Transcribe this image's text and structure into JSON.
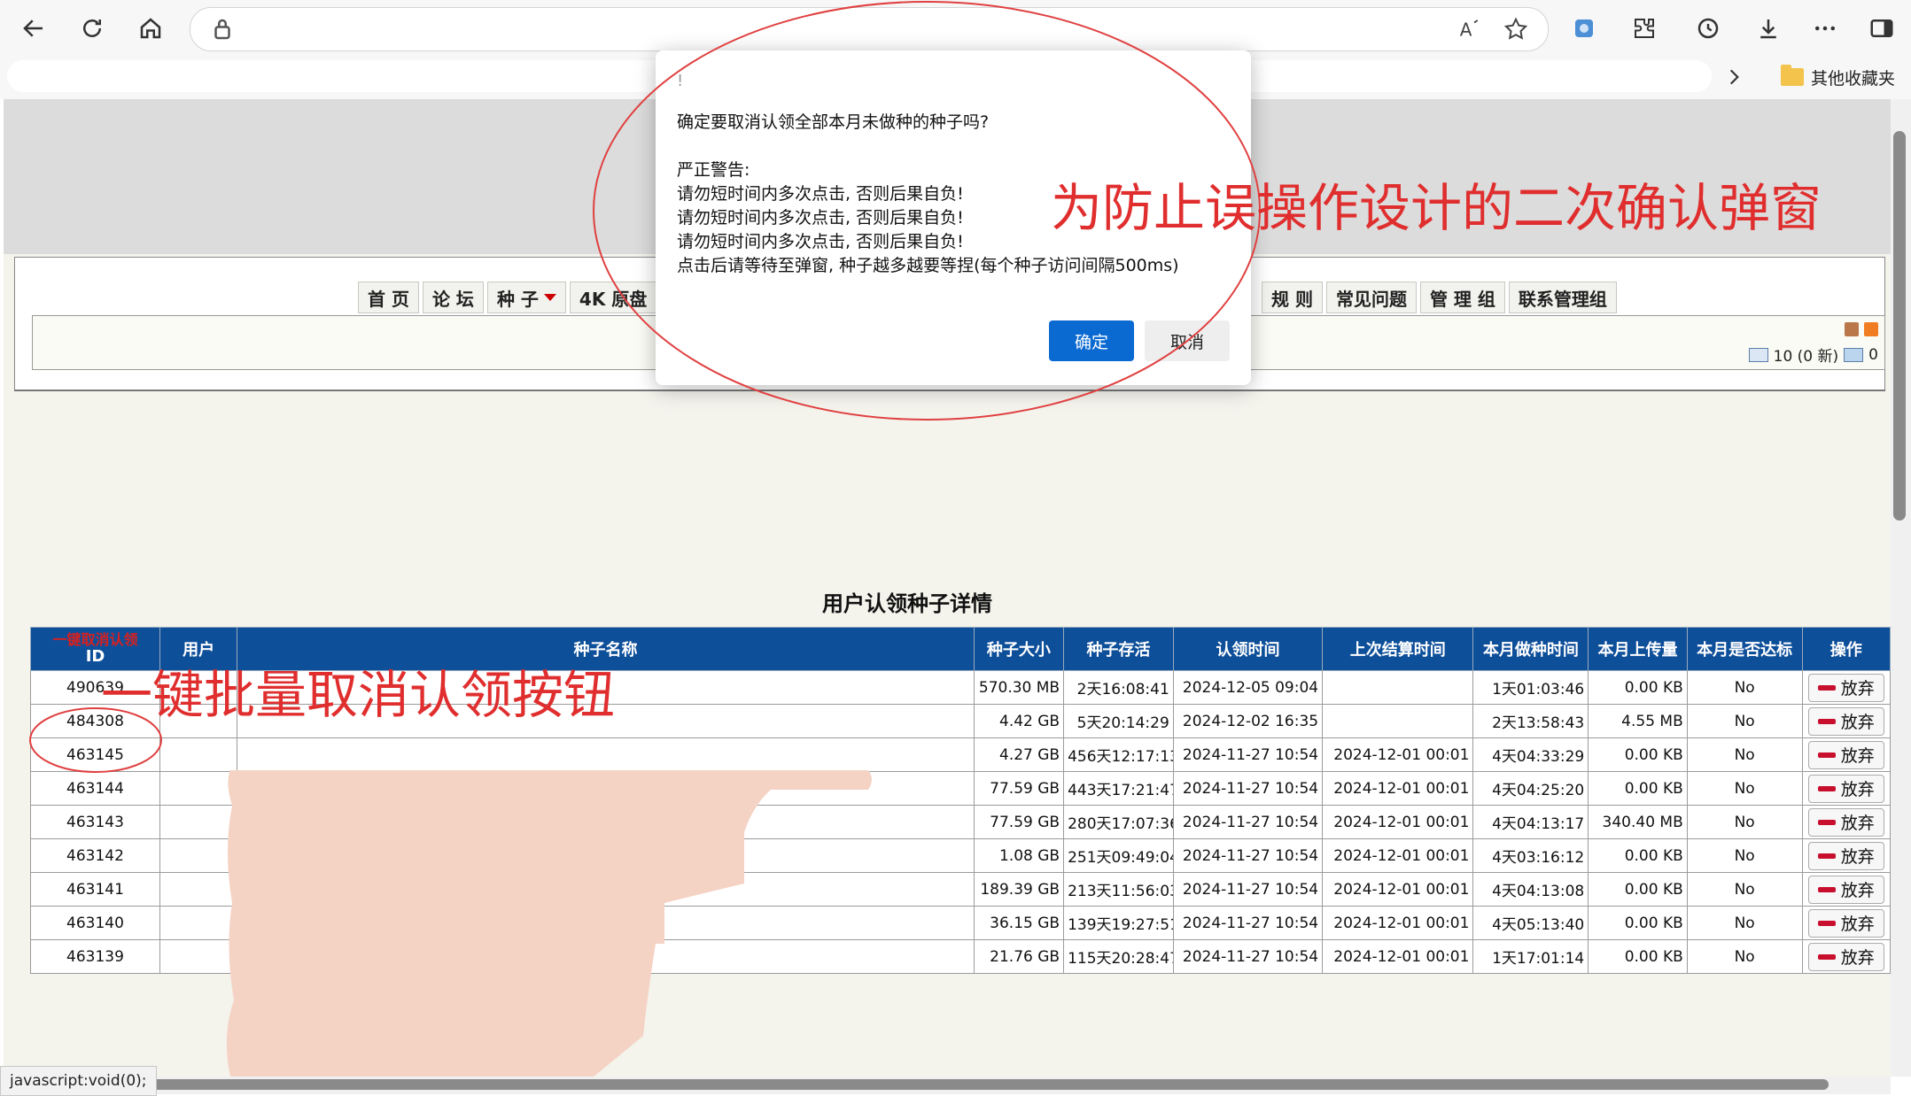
{
  "browser": {
    "icons": [
      "back-icon",
      "refresh-icon",
      "home-icon",
      "lock-icon",
      "read-aloud-icon",
      "favorite-star-icon",
      "extension-icon",
      "puzzle-icon",
      "history-icon",
      "download-icon",
      "more-icon",
      "sidebar-icon"
    ],
    "favorites_folder": "其他收藏夹"
  },
  "nav": {
    "left": [
      "首 页",
      "论 坛",
      "种 子",
      "4K 原盘"
    ],
    "right": [
      "规 则",
      "常见问题",
      "管 理 组",
      "联系管理组"
    ]
  },
  "user_info": {
    "messages": "10 (0 新)",
    "other_count": "0"
  },
  "dialog": {
    "title": "!",
    "question": "确定要取消认领全部本月未做种的种子吗?",
    "warning_title": "严正警告:",
    "warnings": [
      "请勿短时间内多次点击, 否则后果自负!",
      "请勿短时间内多次点击, 否则后果自负!",
      "请勿短时间内多次点击, 否则后果自负!",
      "点击后请等待至弹窗, 种子越多越要等捏(每个种子访问间隔500ms)"
    ],
    "ok_label": "确定",
    "cancel_label": "取消"
  },
  "annotations": {
    "dialog_note": "为防止误操作设计的二次确认弹窗",
    "button_note": "一键批量取消认领按钮"
  },
  "table": {
    "title": "用户认领种子详情",
    "batch_button": "一键取消认领",
    "columns": [
      "ID",
      "用户",
      "种子名称",
      "种子大小",
      "种子存活",
      "认领时间",
      "上次结算时间",
      "本月做种时间",
      "本月上传量",
      "本月是否达标",
      "操作"
    ],
    "action_label": "放弃",
    "rows": [
      [
        "490639",
        "",
        "",
        "570.30 MB",
        "2天16:08:41",
        "2024-12-05 09:04",
        "",
        "1天01:03:46",
        "0.00 KB",
        "No"
      ],
      [
        "484308",
        "",
        "",
        "4.42 GB",
        "5天20:14:29",
        "2024-12-02 16:35",
        "",
        "2天13:58:43",
        "4.55 MB",
        "No"
      ],
      [
        "463145",
        "",
        "",
        "4.27 GB",
        "456天12:17:13",
        "2024-11-27 10:54",
        "2024-12-01 00:01",
        "4天04:33:29",
        "0.00 KB",
        "No"
      ],
      [
        "463144",
        "",
        "",
        "77.59 GB",
        "443天17:21:47",
        "2024-11-27 10:54",
        "2024-12-01 00:01",
        "4天04:25:20",
        "0.00 KB",
        "No"
      ],
      [
        "463143",
        "",
        "",
        "77.59 GB",
        "280天17:07:36",
        "2024-11-27 10:54",
        "2024-12-01 00:01",
        "4天04:13:17",
        "340.40 MB",
        "No"
      ],
      [
        "463142",
        "",
        "",
        "1.08 GB",
        "251天09:49:04",
        "2024-11-27 10:54",
        "2024-12-01 00:01",
        "4天03:16:12",
        "0.00 KB",
        "No"
      ],
      [
        "463141",
        "",
        "",
        "189.39 GB",
        "213天11:56:03",
        "2024-11-27 10:54",
        "2024-12-01 00:01",
        "4天04:13:08",
        "0.00 KB",
        "No"
      ],
      [
        "463140",
        "",
        "",
        "36.15 GB",
        "139天19:27:51",
        "2024-11-27 10:54",
        "2024-12-01 00:01",
        "4天05:13:40",
        "0.00 KB",
        "No"
      ],
      [
        "463139",
        "",
        "",
        "21.76 GB",
        "115天20:28:47",
        "2024-11-27 10:54",
        "2024-12-01 00:01",
        "1天17:01:14",
        "0.00 KB",
        "No"
      ]
    ]
  },
  "status_bar": "javascript:void(0);",
  "colors": {
    "header_blue": "#0e4f9a",
    "annotation_red": "#e02e2e",
    "ok_blue": "#0a6ad1",
    "redaction": "#f5d3c4"
  }
}
